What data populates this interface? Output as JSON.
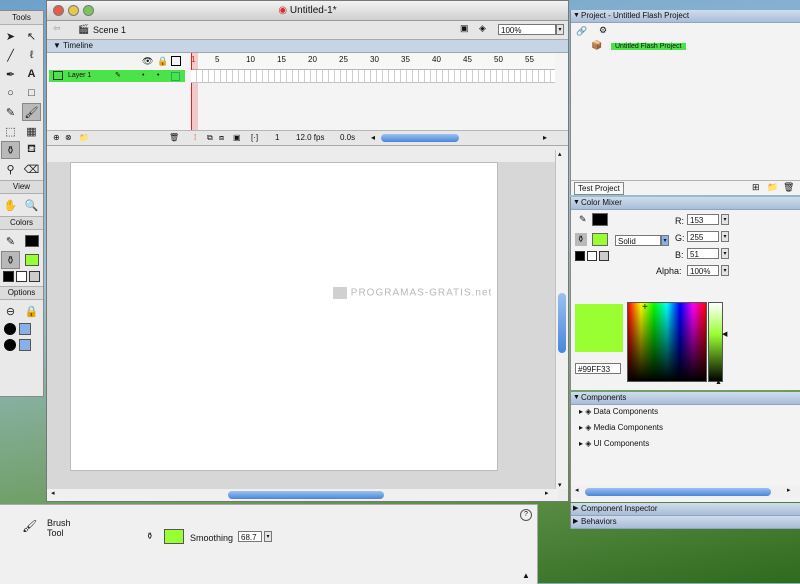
{
  "tools_panel": {
    "title": "Tools",
    "view_label": "View",
    "colors_label": "Colors",
    "options_label": "Options",
    "icons": [
      "arrow-icon",
      "subselect-icon",
      "line-icon",
      "lasso-icon",
      "pen-icon",
      "text-icon",
      "oval-icon",
      "rectangle-icon",
      "pencil-icon",
      "brush-icon",
      "free-transform-icon",
      "fill-transform-icon",
      "ink-bottle-icon",
      "paint-bucket-icon",
      "eyedropper-icon",
      "eraser-icon"
    ]
  },
  "main_window": {
    "title": "Untitled-1*",
    "scene": "Scene 1",
    "zoom": "100%",
    "timeline_label": "Timeline",
    "layer_name": "Layer 1",
    "ruler_numbers": [
      "5",
      "10",
      "15",
      "20",
      "25",
      "30",
      "35",
      "40",
      "45",
      "50",
      "55"
    ],
    "status_frame": "1",
    "status_fps": "12.0 fps",
    "status_time": "0.0s"
  },
  "watermark": "PROGRAMAS-GRATIS.net",
  "properties": {
    "tool_name": "Brush",
    "tool_name2": "Tool",
    "smoothing_label": "Smoothing",
    "smoothing_value": "68.7",
    "swatch_color": "#99FF33"
  },
  "project_panel": {
    "title": "Project - Untitled Flash Project",
    "project_name": "Untitled Flash Project",
    "test_button": "Test Project"
  },
  "color_mixer": {
    "title": "Color Mixer",
    "r_label": "R:",
    "r_value": "153",
    "g_label": "G:",
    "g_value": "255",
    "b_label": "B:",
    "b_value": "51",
    "alpha_label": "Alpha:",
    "alpha_value": "100%",
    "fill_type": "Solid",
    "hex_value": "#99FF33",
    "accent": "#99FF33"
  },
  "components_panel": {
    "title": "Components",
    "items": [
      "Data Components",
      "Media Components",
      "UI Components"
    ]
  },
  "collapsed_panels": {
    "inspector": "Component Inspector",
    "behaviors": "Behaviors"
  }
}
